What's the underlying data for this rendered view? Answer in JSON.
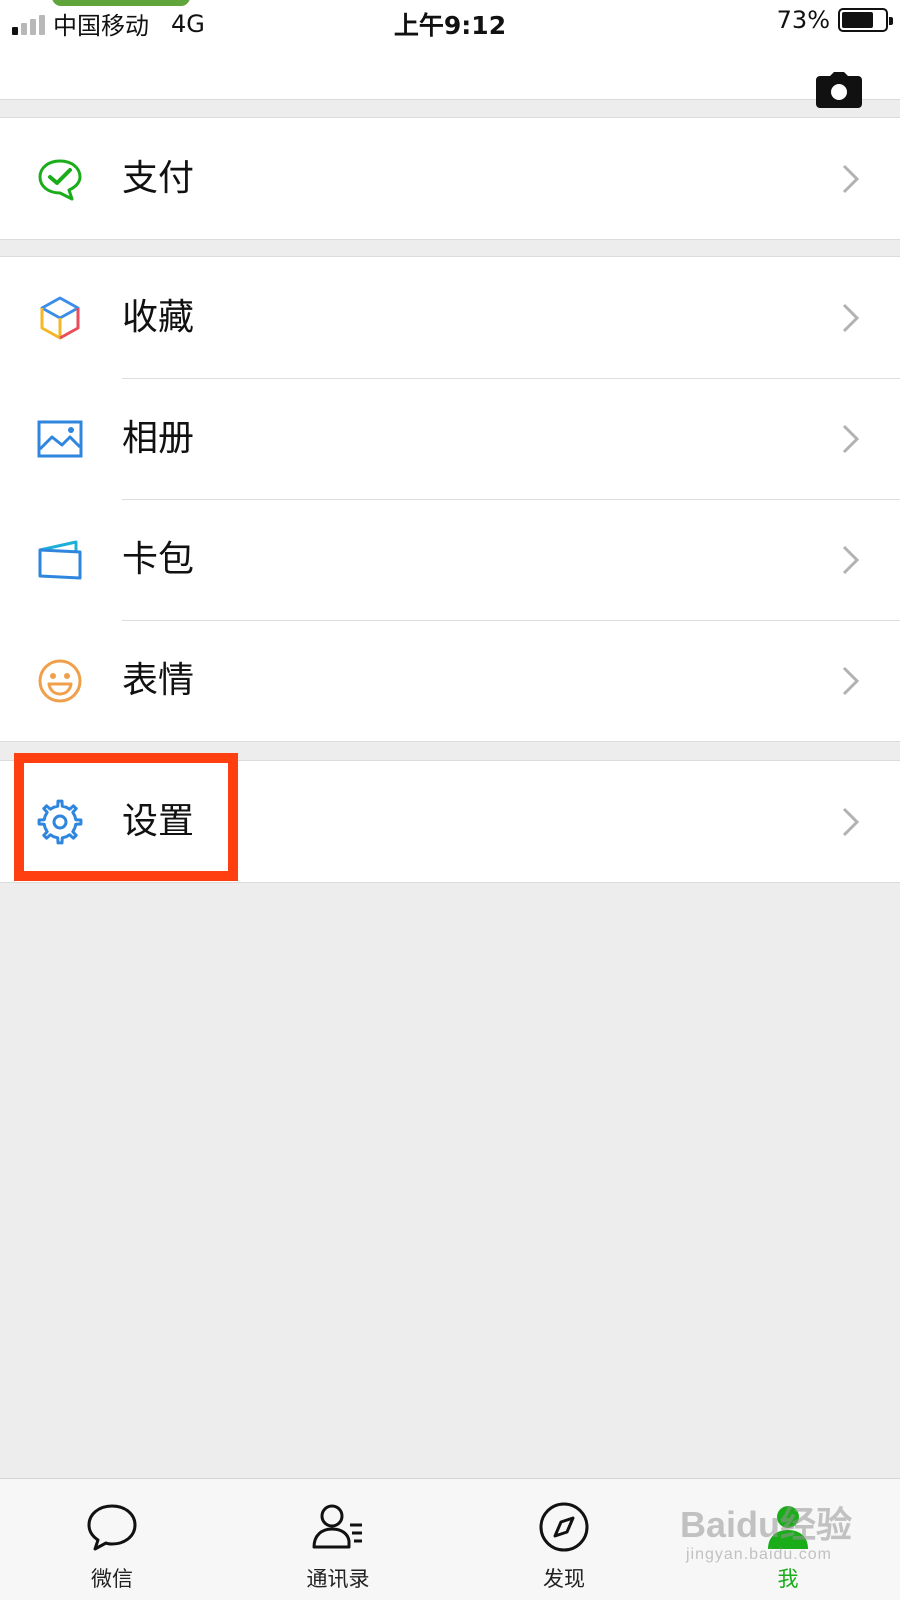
{
  "status_bar": {
    "carrier": "中国移动",
    "network": "4G",
    "time": "上午9:12",
    "battery_percent": "73%",
    "battery_level": 0.73
  },
  "menu_groups": [
    {
      "items": [
        {
          "label": "支付",
          "icon": "wechat-pay-icon"
        }
      ]
    },
    {
      "items": [
        {
          "label": "收藏",
          "icon": "favorites-cube-icon"
        },
        {
          "label": "相册",
          "icon": "photo-album-icon"
        },
        {
          "label": "卡包",
          "icon": "card-wallet-icon"
        },
        {
          "label": "表情",
          "icon": "smiley-face-icon"
        }
      ]
    },
    {
      "items": [
        {
          "label": "设置",
          "icon": "gear-icon"
        }
      ]
    }
  ],
  "tabbar": {
    "tabs": [
      {
        "label": "微信",
        "icon": "chat-bubble-icon"
      },
      {
        "label": "通讯录",
        "icon": "contacts-icon"
      },
      {
        "label": "发现",
        "icon": "compass-icon"
      },
      {
        "label": "我",
        "icon": "me-person-icon",
        "active": true
      }
    ]
  },
  "watermark": {
    "brand": "Baidu经验",
    "url": "jingyan.baidu.com"
  },
  "colors": {
    "accent_green": "#1aad19",
    "highlight_box": "#ff3f0f",
    "background": "#ededed"
  }
}
